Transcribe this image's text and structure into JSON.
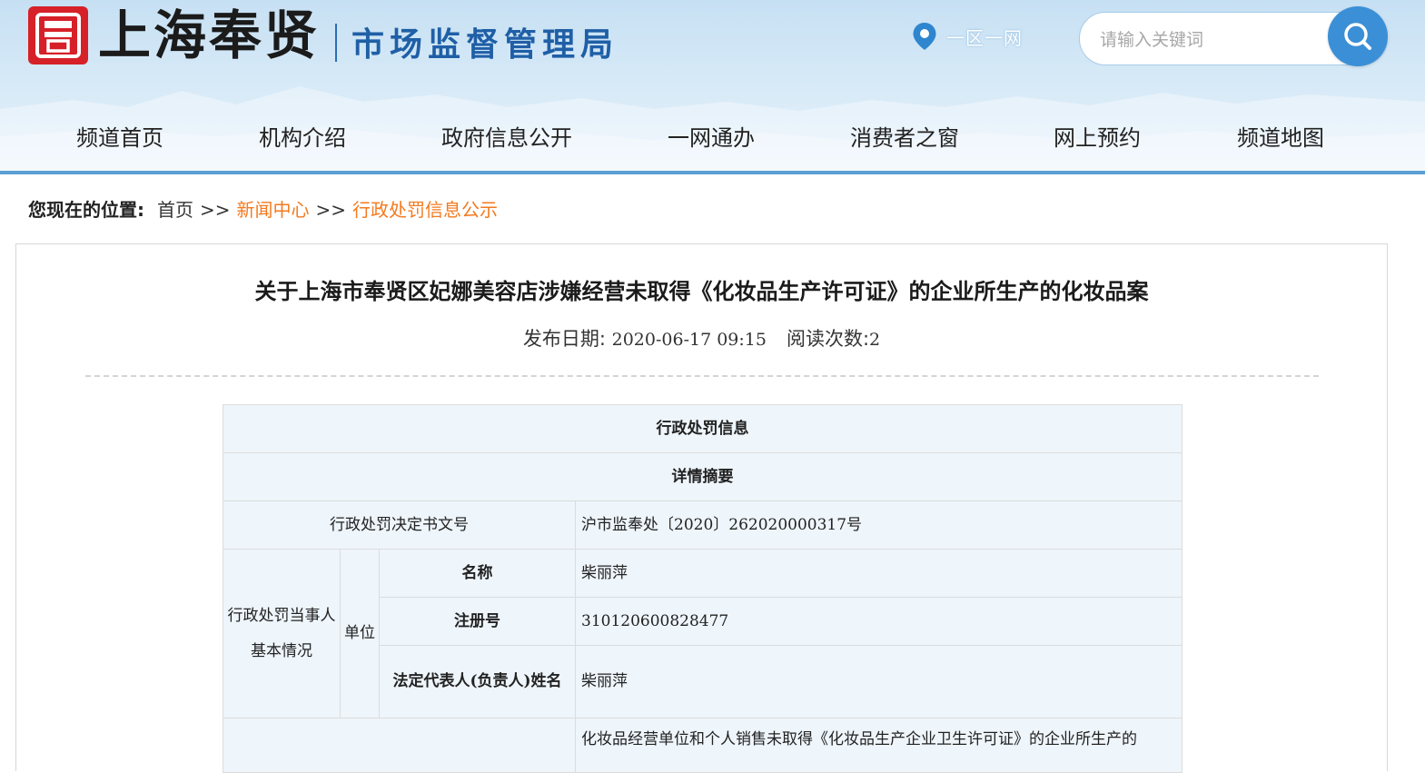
{
  "header": {
    "logo_seal_icon": "red-seal-icon",
    "site_name": "上海奉贤",
    "department": "市场监督管理局",
    "location_icon": "map-pin-icon",
    "yiqu_label": "一区一网",
    "search_placeholder": "请输入关键词",
    "search_icon": "search-icon",
    "colors": {
      "nav_line": "#5b9fd4",
      "search_button": "#3b8fd6",
      "seal": "#d62128",
      "accent_link": "#f47a1f"
    }
  },
  "nav": {
    "items": [
      {
        "label": "频道首页"
      },
      {
        "label": "机构介绍"
      },
      {
        "label": "政府信息公开"
      },
      {
        "label": "一网通办"
      },
      {
        "label": "消费者之窗"
      },
      {
        "label": "网上预约"
      },
      {
        "label": "频道地图"
      }
    ]
  },
  "breadcrumb": {
    "label": "您现在的位置:",
    "home": "首页",
    "separator": ">>",
    "items": [
      "新闻中心",
      "行政处罚信息公示"
    ]
  },
  "article": {
    "title": "关于上海市奉贤区妃娜美容店涉嫌经营未取得《化妆品生产许可证》的企业所生产的化妆品案",
    "publish_label": "发布日期:",
    "publish_date": "2020-06-17 09:15",
    "reads_label": "阅读次数:",
    "reads": "2"
  },
  "table": {
    "header1": "行政处罚信息",
    "header2": "详情摘要",
    "decision_no_label": "行政处罚决定书文号",
    "decision_no": "沪市监奉处〔2020〕262020000317号",
    "party_label": "行政处罚当事人基本情况",
    "unit_label": "单位",
    "name_label": "名称",
    "name_value": "柴丽萍",
    "reg_label": "注册号",
    "reg_value": "310120600828477",
    "legal_rep_label": "法定代表人(负责人)姓名",
    "legal_rep_value": "柴丽萍",
    "violation_text": "化妆品经营单位和个人销售未取得《化妆品生产企业卫生许可证》的企业所生产的"
  }
}
